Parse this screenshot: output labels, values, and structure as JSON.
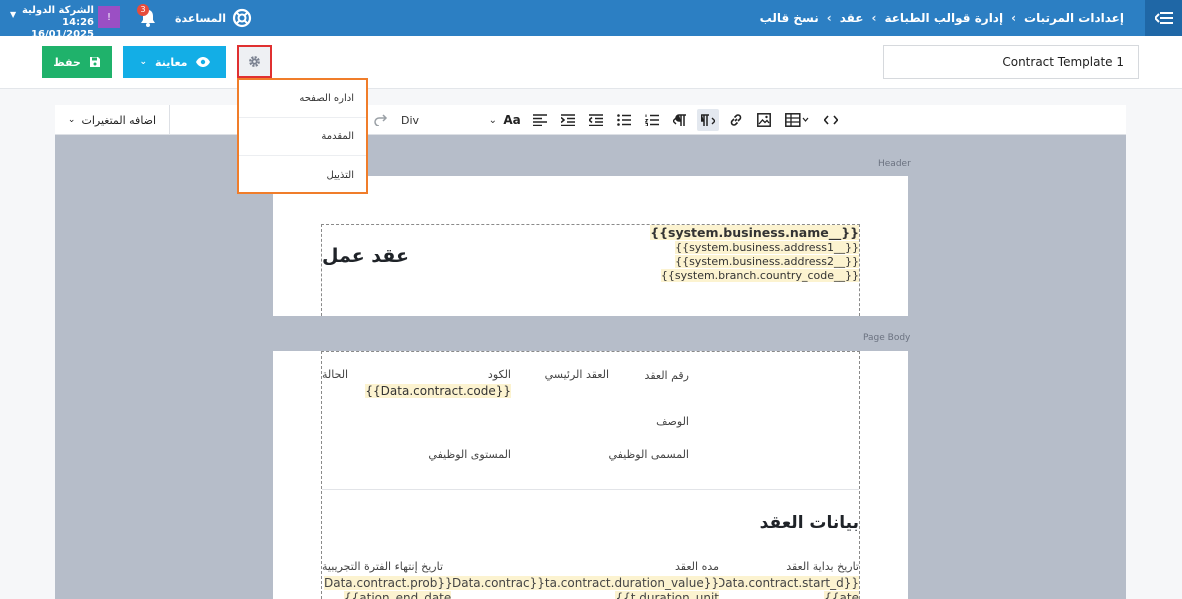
{
  "topbar": {
    "breadcrumbs": [
      "إعدادات المرتبات",
      "إدارة قوالب الطباعة",
      "عقد",
      "نسخ قالب"
    ],
    "help_label": "المساعدة",
    "notification_count": "3",
    "avatar_letter": "!",
    "company_name": "الشركة الدولية",
    "datetime": "14:26 16/01/2025"
  },
  "actions": {
    "title_value": "Contract Template 1",
    "save_label": "حفظ",
    "preview_label": "معاينة"
  },
  "gear_menu": {
    "items": [
      "اداره الصفحه",
      "المقدمة",
      "التذييل"
    ]
  },
  "editor_toolbar": {
    "add_variables_label": "اضافه المتغيرات",
    "block_format": "Div"
  },
  "sections": {
    "header_label": "Header",
    "body_label": "Page Body"
  },
  "header_content": {
    "title": "عقد عمل",
    "business_name": "{{system.business.name__}}",
    "address1": "{{system.business.address1__}}",
    "address2": "{{system.business.address2__}}",
    "country_code": "{{system.branch.country_code__}}"
  },
  "body_content": {
    "contract_number_label": "رقم العقد",
    "parent_contract_label": "العقد الرئيسي",
    "code_label": "الكود",
    "status_label": "الحالة",
    "code_value": "{{Data.contract.code}}",
    "description_label": "الوصف",
    "job_title_label": "المسمى الوظيفي",
    "job_level_label": "المستوى الوظيفي",
    "section_title": "بيانات العقد",
    "start_date_label": "تاريخ بداية العقد",
    "duration_label": "مده العقد",
    "probation_end_label": "تاريخ إنتهاء الفترة التجريبية",
    "start_date_value": "Data.contract.start_d}}",
    "start_date_value2": "{{ate",
    "duration_value": "{{Data.contract.duration_value}}",
    "duration_unit_value": "{{t.duration_unit",
    "duration_extra": "Data.contrac}}",
    "probation_value": "Data.contract.prob}}",
    "probation_value2": "{{ation_end_date"
  },
  "colors": {
    "topbar": "#2c7fc3",
    "save": "#1fb26b",
    "preview": "#13aee6",
    "menu_border": "#f07d2a",
    "gear_border": "#e03030",
    "highlight": "#fcf3d0"
  }
}
